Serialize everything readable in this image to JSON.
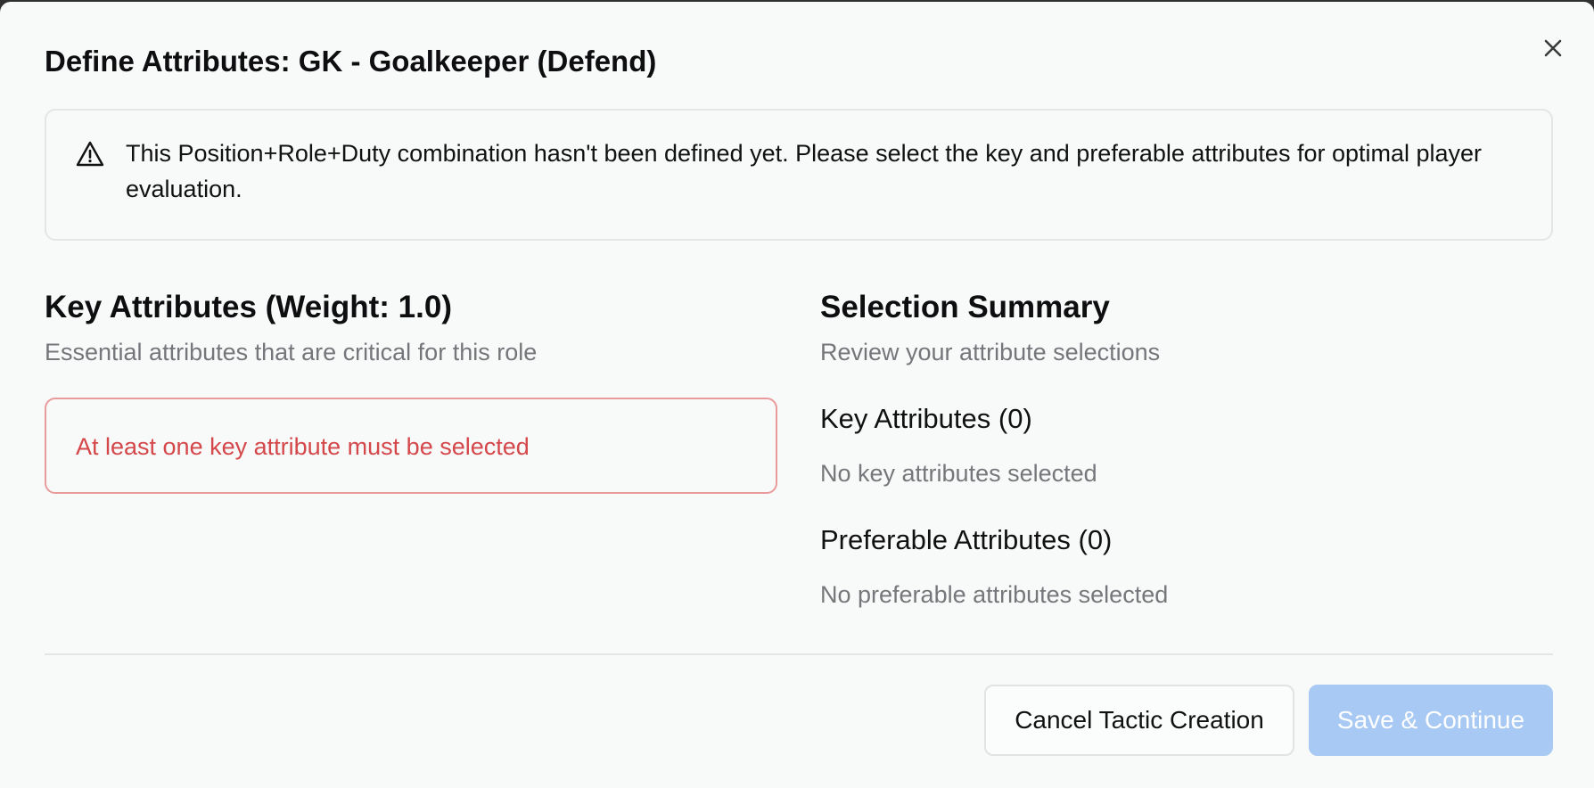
{
  "dialog": {
    "title": "Define Attributes: GK - Goalkeeper (Defend)",
    "close_icon": "close-icon",
    "alert": {
      "icon": "warning-triangle-icon",
      "text": "This Position+Role+Duty combination hasn't been defined yet. Please select the key and preferable attributes for optimal player evaluation."
    },
    "key_attributes": {
      "title": "Key Attributes (Weight: 1.0)",
      "description": "Essential attributes that are critical for this role",
      "error": "At least one key attribute must be selected"
    },
    "summary": {
      "title": "Selection Summary",
      "description": "Review your attribute selections",
      "key_heading": "Key Attributes (0)",
      "key_empty": "No key attributes selected",
      "preferable_heading": "Preferable Attributes (0)",
      "preferable_empty": "No preferable attributes selected"
    },
    "footer": {
      "cancel_label": "Cancel Tactic Creation",
      "save_label": "Save & Continue"
    }
  },
  "colors": {
    "error": "#d4474a",
    "error_border": "#e99a9b",
    "save_disabled": "#a7c9f3",
    "muted_text": "#75767a"
  }
}
